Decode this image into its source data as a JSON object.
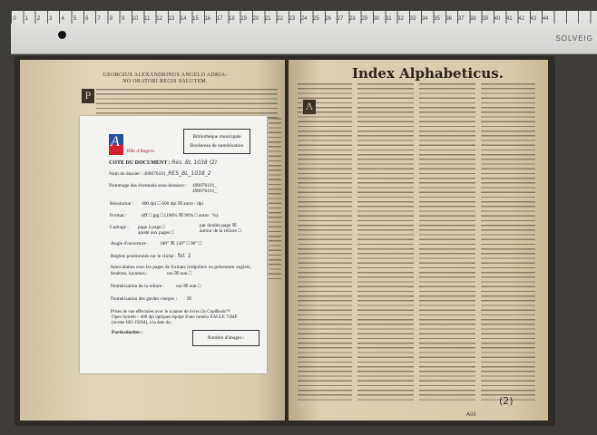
{
  "ruler": {
    "start": 0,
    "end": 44,
    "brand": "SOLVEIG"
  },
  "left_page": {
    "heading_line1": "GEORGIUS ALEXANDRINUS ANGELO ADRIA-",
    "heading_line2": "NO ORATORI REGIS SALUTEM.",
    "dropcap": "P"
  },
  "right_page": {
    "title": "Index Alphabeticus.",
    "dropcap": "A",
    "signature": "Aiiii",
    "folio_handwritten": "(2)"
  },
  "form": {
    "logo_text": "Ville d'Angers",
    "logo_letter": "A",
    "institution": "Bibliothèque municipale",
    "form_title": "Bordereau de numérisation",
    "cote_label": "COTE DU DOCUMENT :",
    "cote_value": "Rés. BL 1038 (2)",
    "dossier_label": "Nom du dossier : 490076101_",
    "dossier_value": "RES_BL_1038_2",
    "sous_label": "Nommage des éventuels sous-dossiers :",
    "sous_value1": "490076101_",
    "sous_value2": "490076101_",
    "resolution_label": "Résolution :",
    "resolution_opts": "400 dpi □    600 dpi ☒    autre :     dpi",
    "format_label": "Format :",
    "format_opts": "tiff □   jpg □ (100% ☒   90% □   autre :    %)",
    "cadrage_label": "Cadrage :",
    "cadrage_opt1": "page à page □",
    "cadrage_opt2": "ajusté aux pages □",
    "cadrage_opt3": "par double page ☒",
    "cadrage_opt4": "autour de la reliure □",
    "angle_label": "Angle d'ouverture :",
    "angle_opts": "180° ☒    120° □    90° □",
    "reglets_label": "Réglets positionnés sur le cliché :",
    "reglets_value": "fol. 1",
    "intercal_label1": "Intercalaires sous les pages de formats irréguliers ou présentant onglets,",
    "intercal_label2": "fenêtres, lucarnes :",
    "intercal_opts": "oui ☒   non □",
    "reliure_label": "Numérisation de la reliure :",
    "reliure_opts": "oui ☒   non □",
    "gardes_label": "Numérisation des gardes vierges :",
    "gardes_opts": "☒",
    "prises_1": "Prises de vue effectuées avec le scanner de livres i2s CopiBook™",
    "prises_2": "Open System – 400 dpi optiques équipé d'une caméra EAGLE 71MP",
    "prises_3": "(norme ISO 19264), à la date du :",
    "particularites_label": "Particularités :",
    "nombre_images_label": "Nombre d'images :"
  }
}
